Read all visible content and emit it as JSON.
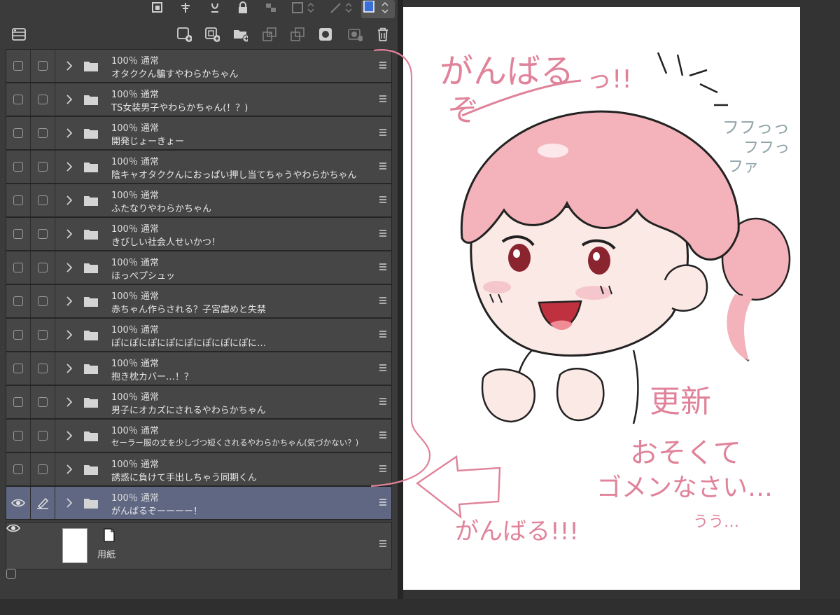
{
  "layers": [
    {
      "opacity_mode": "100％ 通常",
      "name": "オタククん騙すやわらかちゃん"
    },
    {
      "opacity_mode": "100％ 通常",
      "name": "TS女装男子やわらかちゃん(！？)"
    },
    {
      "opacity_mode": "100％ 通常",
      "name": "開発じょーきょー"
    },
    {
      "opacity_mode": "100％ 通常",
      "name": "陰キャオタククんにおっぱい押し当てちゃうやわらかちゃん"
    },
    {
      "opacity_mode": "100％ 通常",
      "name": "ふたなりやわらかちゃん"
    },
    {
      "opacity_mode": "100％ 通常",
      "name": "きびしい社会人せいかつ！"
    },
    {
      "opacity_mode": "100％ 通常",
      "name": "ほっぺプシュッ"
    },
    {
      "opacity_mode": "100％ 通常",
      "name": "赤ちゃん作らされる？子宮虐めと失禁"
    },
    {
      "opacity_mode": "100％ 通常",
      "name": "ぽにぽにぽにぽにぽにぽにぽにぽに…"
    },
    {
      "opacity_mode": "100％ 通常",
      "name": "抱き枕カバー…！？"
    },
    {
      "opacity_mode": "100％ 通常",
      "name": "男子にオカズにされるやわらかちゃん"
    },
    {
      "opacity_mode": "100％ 通常",
      "name": "セーラー服の丈を少しづつ短くされるやわらかちゃん(気づかない？)"
    },
    {
      "opacity_mode": "100％ 通常",
      "name": "誘惑に負けて手出しちゃう同期くん"
    },
    {
      "opacity_mode": "100％ 通常",
      "name": "がんばるぞーーーー！",
      "selected": true
    }
  ],
  "paper_layer": {
    "name": "用紙"
  },
  "canvas_text": {
    "line1": "がんばる",
    "line2": "ぞ",
    "exclaim": "っ!!",
    "sfx": "フフっっ",
    "sfx2": "フフっ",
    "sfx3": "ファ",
    "update": "更新",
    "late1": "おそくて",
    "late2": "ゴメンなさい…",
    "cry": "うう…",
    "cheer": "がんばる!!!"
  },
  "colors": {
    "panel_bg": "#3b3b3b",
    "row_bg": "#464646",
    "selected_row": "#5f6783",
    "ink_pink": "#e0839a",
    "hair_pink": "#f4b3ba",
    "color_swatch": "#3a6fd8"
  }
}
